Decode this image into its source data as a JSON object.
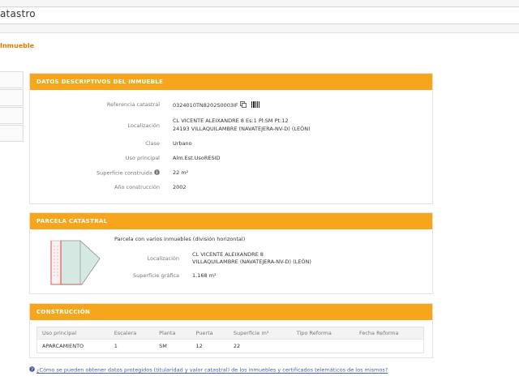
{
  "header": {
    "title": "atastro"
  },
  "page": {
    "title": "Inmueble"
  },
  "datos": {
    "header": "DATOS DESCRIPTIVOS DEL INMUEBLE",
    "fields": [
      {
        "label": "Referencia catastral",
        "value": "0324010TN8202S0003IF"
      },
      {
        "label": "Localización",
        "value": "CL VICENTE ALEIXANDRE 8 Es:1 Pl:SM Pt:12",
        "value2": "24193 VILLAQUILAMBRE (NAVATEJERA-NV-D) (LEÓN)"
      },
      {
        "label": "Clase",
        "value": "Urbano"
      },
      {
        "label": "Uso principal",
        "value": "Alm.Est.UsoRESID"
      },
      {
        "label": "Superficie construida",
        "value": "22 m²"
      },
      {
        "label": "Año construcción",
        "value": "2002"
      }
    ]
  },
  "parcela": {
    "header": "PARCELA CATASTRAL",
    "subtitle": "Parcela con varios inmuebles (división horizontal)",
    "loc_label": "Localización",
    "loc_line1": "CL VICENTE ALEIXANDRE 8",
    "loc_line2": "VILLAQUILAMBRE (NAVATEJERA-NV-D) (LEÓN)",
    "sup_label": "Superficie gráfica",
    "sup_value": "1.168 m²"
  },
  "construccion": {
    "header": "CONSTRUCCIÓN",
    "columns": [
      "Uso principal",
      "Escalera",
      "Planta",
      "Puerta",
      "Superficie m²",
      "Tipo Reforma",
      "Fecha Reforma"
    ],
    "rows": [
      [
        "APARCAMIENTO",
        "1",
        "SM",
        "12",
        "22",
        "",
        ""
      ]
    ]
  },
  "footer": {
    "link_pre": "¿Cómo se pueden obtener datos protegidos (titularidad y valor catastral) de los inmuebles y certificados telemáticos de los mismos?"
  },
  "colors": {
    "accent": "#f7a51a",
    "title": "#e07c00",
    "link": "#4a5ea8"
  },
  "icons": [
    "copy-icon",
    "barcode-icon",
    "info-icon",
    "help-icon"
  ]
}
